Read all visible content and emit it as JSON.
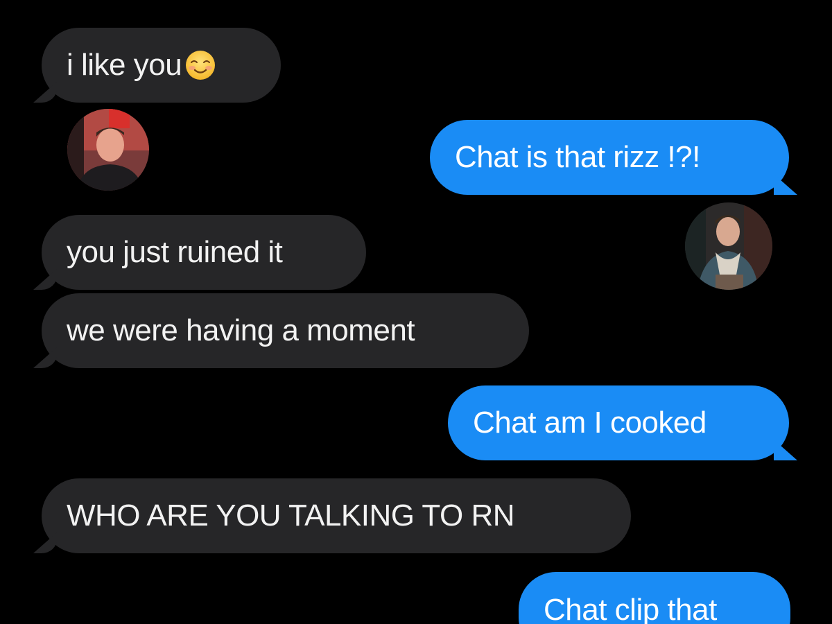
{
  "messages": [
    {
      "from": "them",
      "text": "i like you",
      "emoji": "smiling-face-with-blush"
    },
    {
      "from": "me",
      "text": "Chat is that rizz !?!"
    },
    {
      "from": "them",
      "text": "you just ruined it"
    },
    {
      "from": "them",
      "text": "we were having a moment"
    },
    {
      "from": "me",
      "text": "Chat am I cooked"
    },
    {
      "from": "them",
      "text": "WHO ARE YOU TALKING TO RN"
    },
    {
      "from": "me",
      "text": "Chat clip that"
    }
  ],
  "colors": {
    "background": "#000000",
    "received_bubble": "#262628",
    "sent_bubble": "#1a8cf5",
    "text_light": "#f2f2f2"
  },
  "avatars": [
    {
      "name": "avatar-person-left",
      "icon": "profile-photo"
    },
    {
      "name": "avatar-person-right",
      "icon": "profile-photo"
    }
  ]
}
